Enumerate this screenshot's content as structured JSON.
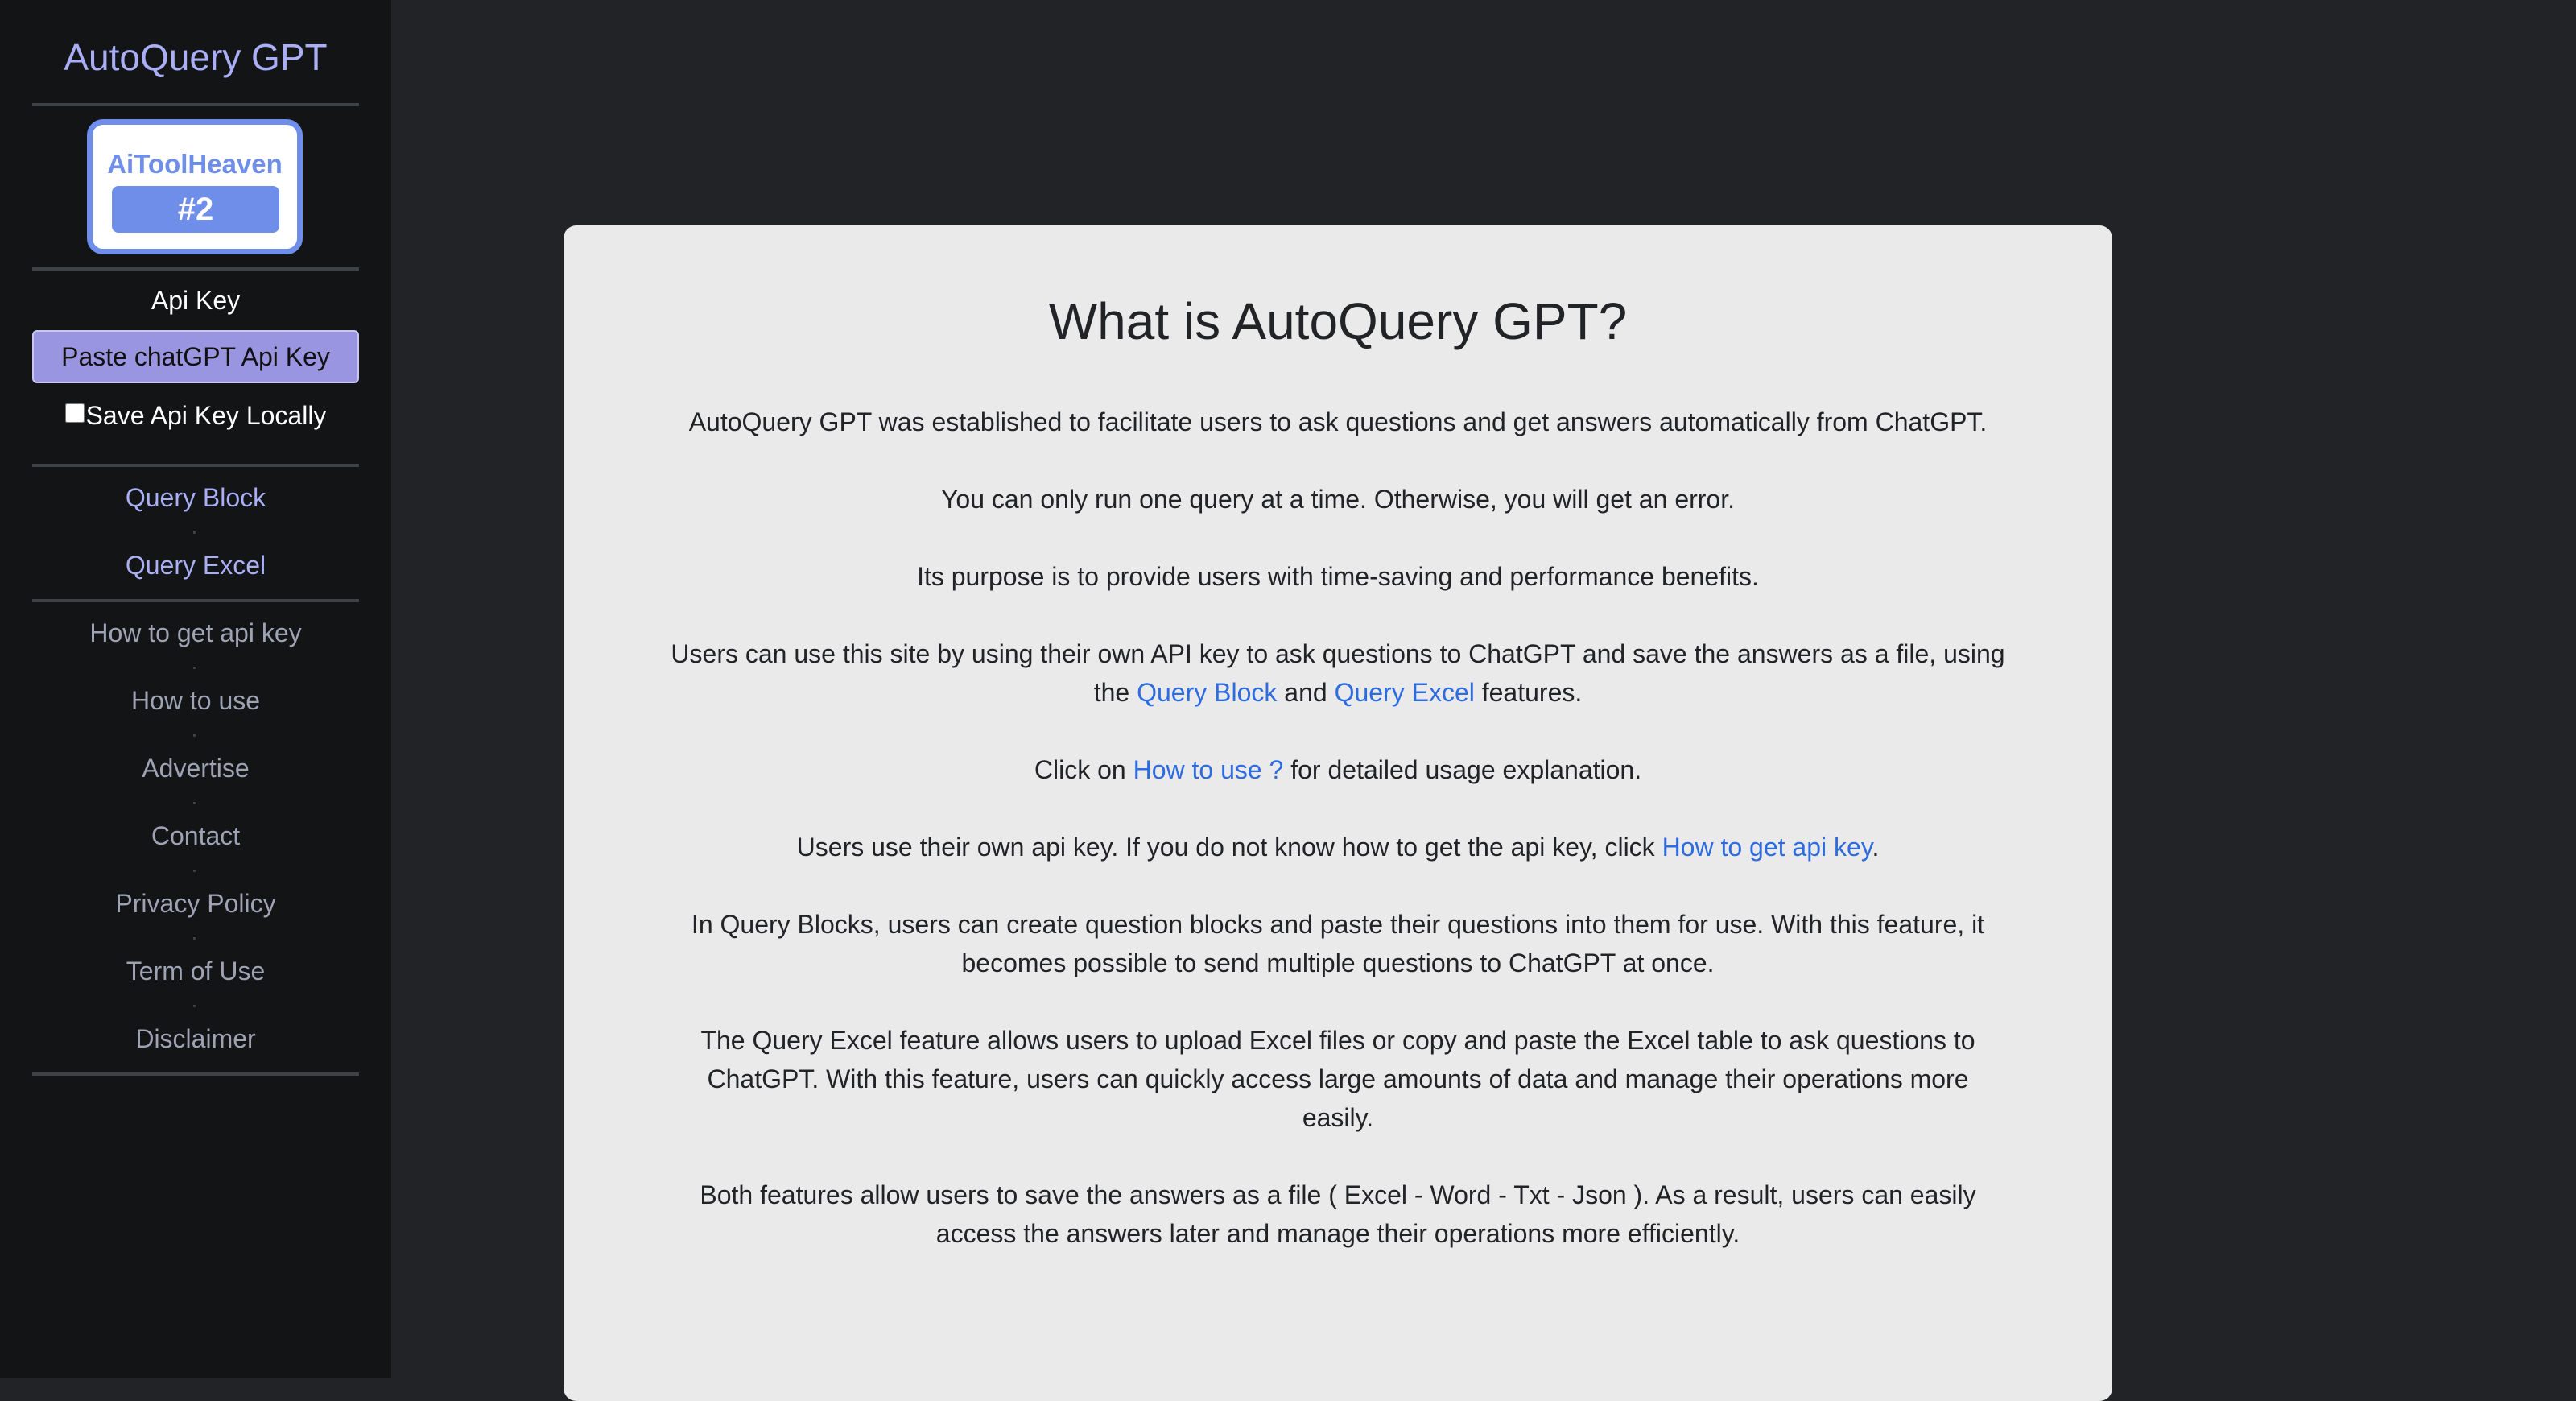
{
  "sidebar": {
    "brand": "AutoQuery GPT",
    "badge": {
      "name": "AiToolHeaven",
      "rank": "#2"
    },
    "api_key_label": "Api Key",
    "api_key_placeholder": "Paste chatGPT Api Key",
    "save_locally_label": "Save Api Key Locally",
    "primary_links": [
      "Query Block",
      "Query Excel"
    ],
    "secondary_links": [
      "How to get api key",
      "How to use",
      "Advertise",
      "Contact",
      "Privacy Policy",
      "Term of Use",
      "Disclaimer"
    ]
  },
  "main": {
    "title": "What is AutoQuery GPT?",
    "p1": "AutoQuery GPT was established to facilitate users to ask questions and get answers automatically from ChatGPT.",
    "p2": "You can only run one query at a time. Otherwise, you will get an error.",
    "p3": "Its purpose is to provide users with time-saving and performance benefits.",
    "p4": {
      "before": "Users can use this site by using their own API key to ask questions to ChatGPT and save the answers as a file, using the ",
      "link1": "Query Block",
      "mid": " and ",
      "link2": "Query Excel",
      "after": " features."
    },
    "p5": {
      "before": "Click on ",
      "link": "How to use ?",
      "after": " for detailed usage explanation."
    },
    "p6": {
      "before": "Users use their own api key. If you do not know how to get the api key, click ",
      "link": "How to get api key",
      "after": "."
    },
    "p7": "In Query Blocks, users can create question blocks and paste their questions into them for use. With this feature, it becomes possible to send multiple questions to ChatGPT at once.",
    "p8": "The Query Excel feature allows users to upload Excel files or copy and paste the Excel table to ask questions to ChatGPT. With this feature, users can quickly access large amounts of data and manage their operations more easily.",
    "p9": "Both features allow users to save the answers as a file ( Excel - Word - Txt - Json ). As a result, users can easily access the answers later and manage their operations more efficiently."
  },
  "colors": {
    "page_bg": "#212327",
    "sidebar_bg": "#121416",
    "card_bg": "#eaeaea",
    "accent": "#a9aef5",
    "badge": "#6f8eea",
    "link": "#2c6be0"
  }
}
